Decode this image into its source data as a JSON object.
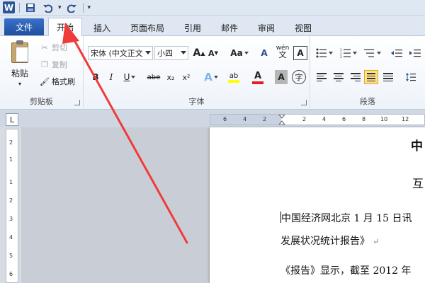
{
  "qat": {
    "logo": "W",
    "save_icon": "save-icon",
    "undo_icon": "undo-icon",
    "redo_icon": "redo-icon"
  },
  "tabs": {
    "file": "文件",
    "items": [
      "开始",
      "插入",
      "页面布局",
      "引用",
      "邮件",
      "审阅",
      "视图"
    ]
  },
  "clipboard": {
    "paste": "粘贴",
    "cut": "剪切",
    "copy": "复制",
    "format_painter": "格式刷",
    "label": "剪贴板"
  },
  "font": {
    "font_name": "宋体 (中文正文",
    "font_size": "小四",
    "grow": "A",
    "shrink": "A",
    "change_case": "Aa",
    "clear": "A",
    "bold": "B",
    "italic": "I",
    "underline": "U",
    "strike": "abe",
    "subscript": "x₂",
    "superscript": "x²",
    "effects": "A",
    "highlight": "ab",
    "color": "A",
    "shading": "A",
    "enclose": "字",
    "phonetic": "wén",
    "label": "字体"
  },
  "paragraph": {
    "label": "段落"
  },
  "colors": {
    "accent": "#1f4f9e",
    "highlight_yellow": "#ffff00",
    "font_red": "#e02020",
    "arrow": "#ef3b3b"
  },
  "hruler": {
    "ticks": [
      "6",
      "4",
      "2",
      "2",
      "4",
      "6",
      "8",
      "10",
      "12"
    ]
  },
  "vruler": {
    "ticks": [
      "2",
      "1",
      "1",
      "2",
      "3",
      "4",
      "5",
      "6",
      "7"
    ]
  },
  "document": {
    "line1": "中",
    "line2": "互",
    "line3": "中国经济网北京 1 月 15 日讯",
    "line4": "发展状况统计报告》",
    "line5": "《报告》显示，截至 2012 年"
  }
}
